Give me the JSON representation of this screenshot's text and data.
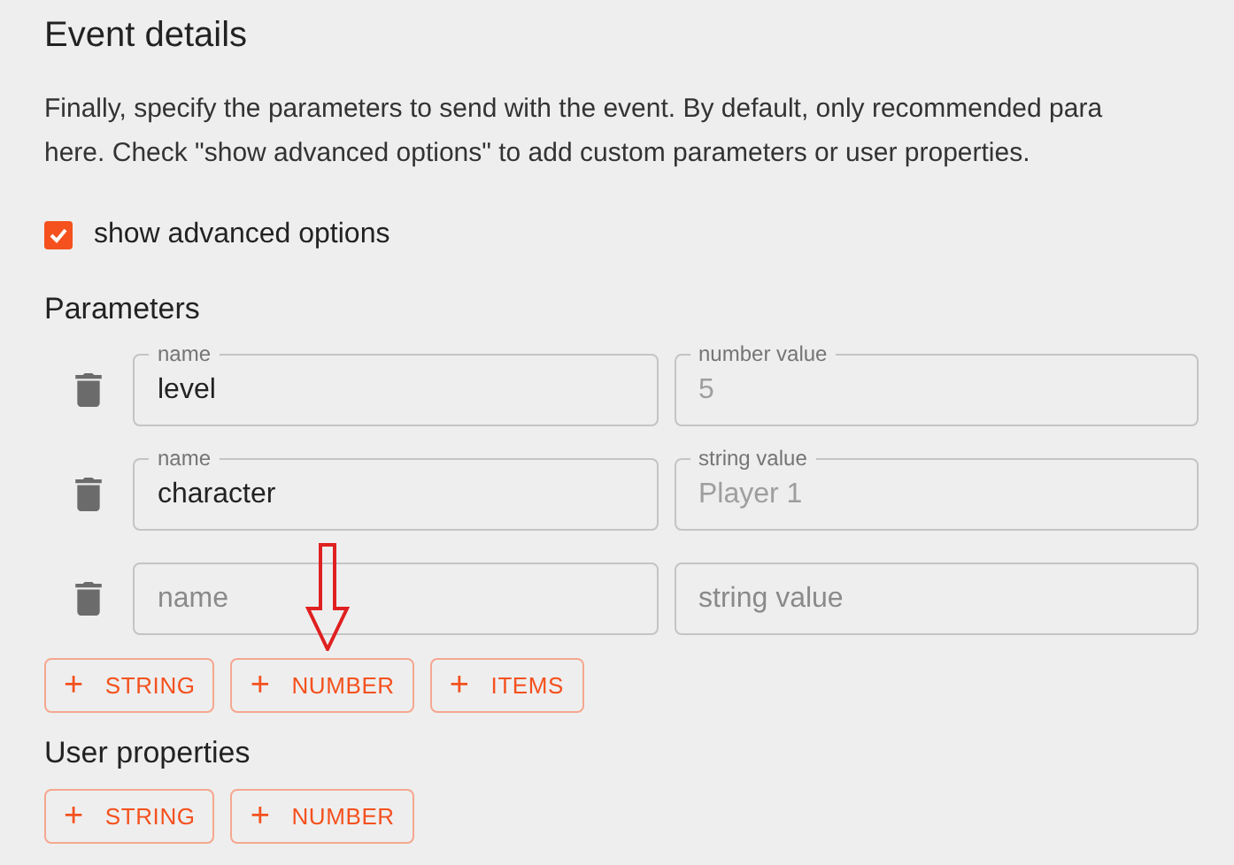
{
  "title": "Event details",
  "description_lines": [
    "Finally, specify the parameters to send with the event. By default, only recommended para",
    "here. Check \"show advanced options\" to add custom parameters or user properties."
  ],
  "advanced_checkbox": {
    "label": "show advanced options",
    "checked": true
  },
  "parameters": {
    "heading": "Parameters",
    "rows": [
      {
        "name_field": {
          "label": "name",
          "value": "level"
        },
        "value_field": {
          "label": "number value",
          "placeholder": "5"
        }
      },
      {
        "name_field": {
          "label": "name",
          "value": "character"
        },
        "value_field": {
          "label": "string value",
          "placeholder": "Player 1"
        }
      },
      {
        "name_field": {
          "placeholder": "name"
        },
        "value_field": {
          "placeholder": "string value"
        }
      }
    ],
    "buttons": [
      {
        "icon": "+",
        "label": "STRING"
      },
      {
        "icon": "+",
        "label": "NUMBER"
      },
      {
        "icon": "+",
        "label": "ITEMS"
      }
    ]
  },
  "user_properties": {
    "heading": "User properties",
    "buttons": [
      {
        "icon": "+",
        "label": "STRING"
      },
      {
        "icon": "+",
        "label": "NUMBER"
      }
    ]
  }
}
